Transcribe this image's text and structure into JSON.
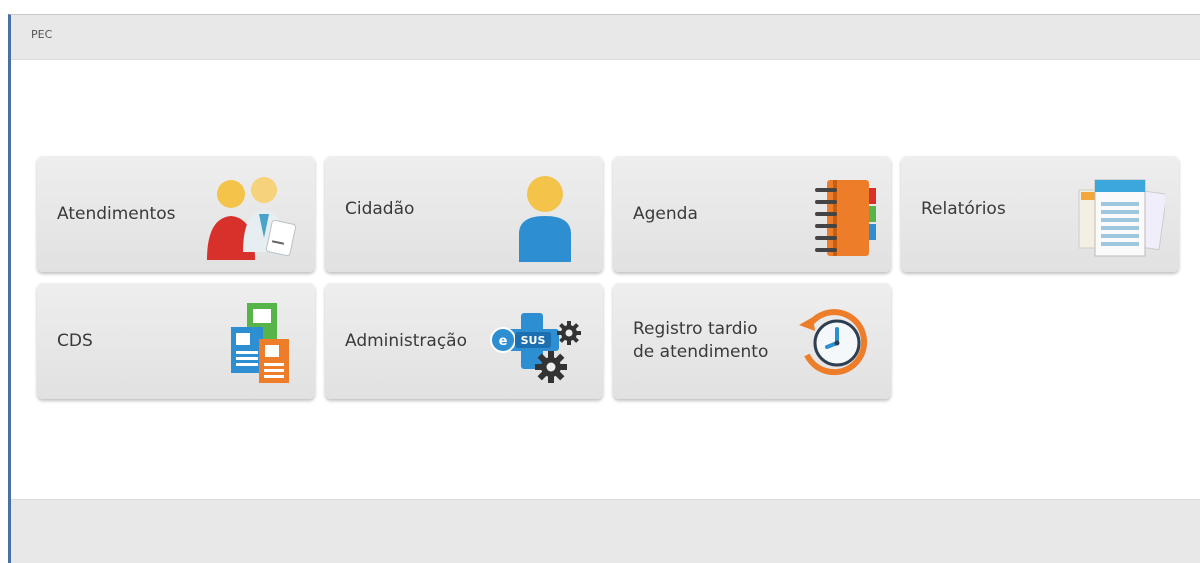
{
  "window": {
    "title": "PEC"
  },
  "tiles": [
    {
      "label": "Atendimentos",
      "icon": "people-icon"
    },
    {
      "label": "Cidadão",
      "icon": "person-icon"
    },
    {
      "label": "Agenda",
      "icon": "notebook-icon"
    },
    {
      "label": "Relatórios",
      "icon": "reports-icon"
    },
    {
      "label": "CDS",
      "icon": "forms-icon"
    },
    {
      "label": "Administração",
      "icon": "esus-gear-icon",
      "badge": "SUS"
    },
    {
      "label": "Registro tardio\nde atendimento",
      "icon": "clock-history-icon"
    }
  ]
}
